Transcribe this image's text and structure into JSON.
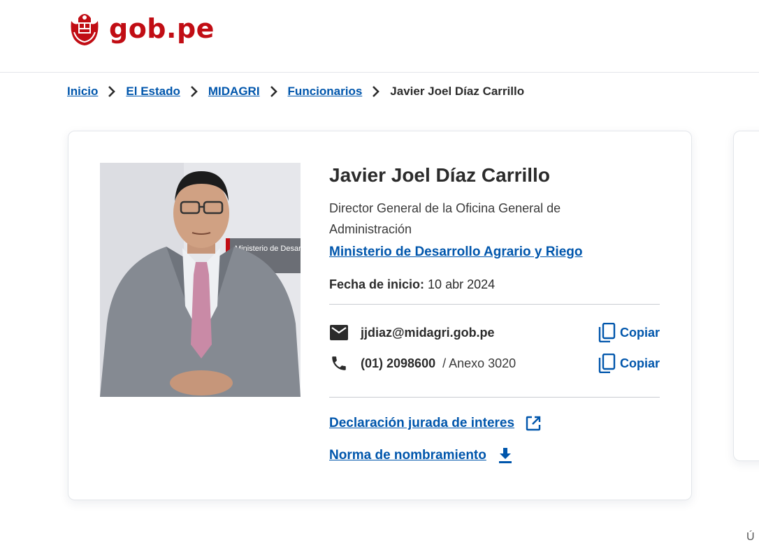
{
  "header": {
    "logo_text": "gob.pe",
    "brand_color": "#c10d14"
  },
  "breadcrumb": {
    "items": [
      "Inicio",
      "El Estado",
      "MIDAGRI",
      "Funcionarios"
    ],
    "current": "Javier Joel Díaz Carrillo"
  },
  "official": {
    "name": "Javier Joel Díaz Carrillo",
    "position": "Director General de la Oficina General de Administración",
    "entity": "Ministerio de Desarrollo Agrario y Riego",
    "start_label": "Fecha de inicio:",
    "start_date": "10 abr 2024",
    "photo_sign_text": "Ministerio de Desarrollo A"
  },
  "contacts": {
    "email": "jjdiaz@midagri.gob.pe",
    "phone": "(01) 2098600",
    "extension": "/ Anexo 3020",
    "copy_label": "Copiar"
  },
  "documents": {
    "declaration_label": "Declaración jurada de interes",
    "appointment_label": "Norma de nombramiento"
  },
  "footer": {
    "corner_text": "Ú"
  },
  "colors": {
    "link": "#0056ac",
    "text": "#2b2b2b"
  },
  "icons": [
    "seal-icon",
    "chevron-right-icon",
    "email-icon",
    "phone-icon",
    "copy-icon",
    "external-link-icon",
    "download-icon"
  ]
}
